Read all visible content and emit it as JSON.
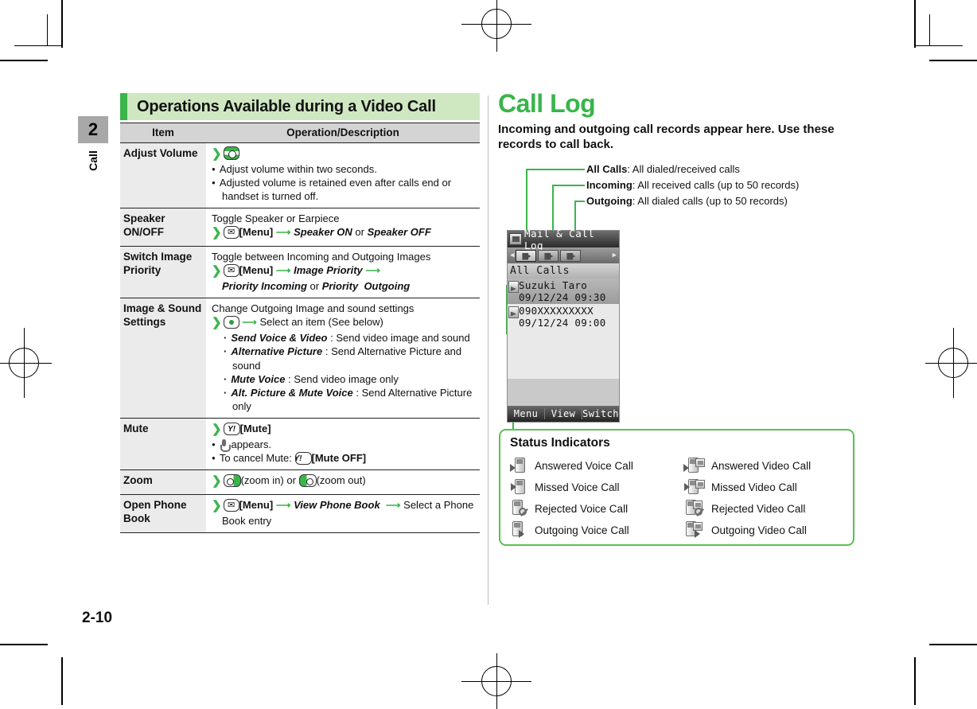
{
  "page": {
    "number": "2-10",
    "chapter_number": "2",
    "chapter_label": "Call"
  },
  "left_column": {
    "heading": "Operations Available during a Video Call",
    "table": {
      "headers": [
        "Item",
        "Operation/Description"
      ],
      "rows": [
        {
          "item": "Adjust Volume",
          "lines": [
            {
              "type": "step",
              "key": "volume-key",
              "text": ""
            },
            {
              "type": "bullet",
              "text": "Adjust volume within two seconds."
            },
            {
              "type": "bullet",
              "text": "Adjusted volume is retained even after calls end or handset is turned off."
            }
          ]
        },
        {
          "item": "Speaker ON/OFF",
          "lines": [
            {
              "type": "plain",
              "text": "Toggle Speaker or Earpiece"
            },
            {
              "type": "step",
              "key": "mail-key",
              "text": "[Menu] → Speaker ON or Speaker OFF"
            }
          ]
        },
        {
          "item": "Switch Image Priority",
          "lines": [
            {
              "type": "plain",
              "text": "Toggle between Incoming and Outgoing Images"
            },
            {
              "type": "step",
              "key": "mail-key",
              "text": "[Menu] → Image Priority →"
            },
            {
              "type": "indent",
              "text": "Priority Incoming or Priority  Outgoing"
            }
          ]
        },
        {
          "item": "Image & Sound Settings",
          "lines": [
            {
              "type": "plain",
              "text": "Change Outgoing Image and sound settings"
            },
            {
              "type": "step",
              "key": "center-key",
              "text": "→ Select an item (See below)"
            },
            {
              "type": "sub",
              "term": "Send Voice & Video",
              "text": ": Send video image and sound"
            },
            {
              "type": "sub",
              "term": "Alternative Picture",
              "text": ": Send Alternative Picture and sound"
            },
            {
              "type": "sub",
              "term": "Mute Voice",
              "text": ": Send video image only"
            },
            {
              "type": "sub",
              "term": "Alt. Picture & Mute Voice",
              "text": ": Send Alternative Picture only"
            }
          ]
        },
        {
          "item": "Mute",
          "lines": [
            {
              "type": "step",
              "key": "yk-key",
              "text": "[Mute]"
            },
            {
              "type": "bullet-icon",
              "icon": "mute-icon",
              "text": "appears."
            },
            {
              "type": "bullet-key",
              "prefix": "To cancel Mute:",
              "key": "yk-key",
              "text": "[Mute OFF]"
            }
          ]
        },
        {
          "item": "Zoom",
          "lines": [
            {
              "type": "step-zoom",
              "zoom_in_label": "(zoom in)",
              "or": "or",
              "zoom_out_label": "(zoom out)"
            }
          ]
        },
        {
          "item": "Open Phone Book",
          "lines": [
            {
              "type": "step",
              "key": "mail-key",
              "text": "[Menu] → View Phone Book  → Select a Phone"
            },
            {
              "type": "indent",
              "text": "Book entry"
            }
          ]
        }
      ]
    }
  },
  "right_column": {
    "title": "Call Log",
    "lede": "Incoming and outgoing call records appear here. Use these records to call back.",
    "callouts": [
      {
        "term": "All Calls",
        "text": ": All dialed/received calls"
      },
      {
        "term": "Incoming",
        "text": ": All received calls (up to 50 records)"
      },
      {
        "term": "Outgoing",
        "text": ": All dialed calls (up to 50 records)"
      }
    ],
    "phone_screen": {
      "title": "Mail & Call Log",
      "sub_header": "All Calls",
      "entries": [
        {
          "name": "Suzuki Taro",
          "date": "09/12/24 09:30",
          "selected": true
        },
        {
          "name": "090XXXXXXXXX",
          "date": "09/12/24 09:00",
          "selected": false
        }
      ],
      "softkeys": [
        "Menu",
        "View",
        "Switch"
      ]
    },
    "status_indicators": {
      "title": "Status Indicators",
      "items": [
        {
          "label": "Answered Voice Call",
          "icon": "answered-voice-call-icon"
        },
        {
          "label": "Answered Video Call",
          "icon": "answered-video-call-icon"
        },
        {
          "label": "Missed Voice Call",
          "icon": "missed-voice-call-icon"
        },
        {
          "label": "Missed Video Call",
          "icon": "missed-video-call-icon"
        },
        {
          "label": "Rejected Voice Call",
          "icon": "rejected-voice-call-icon"
        },
        {
          "label": "Rejected Video Call",
          "icon": "rejected-video-call-icon"
        },
        {
          "label": "Outgoing Voice Call",
          "icon": "outgoing-voice-call-icon"
        },
        {
          "label": "Outgoing Video Call",
          "icon": "outgoing-video-call-icon"
        }
      ]
    }
  },
  "colors": {
    "accent_green": "#3bb54a",
    "heading_bg": "#cfe8c1",
    "table_header_bg": "#d4d4d4",
    "item_cell_bg": "#ebebeb",
    "box_border": "#5bc053"
  }
}
